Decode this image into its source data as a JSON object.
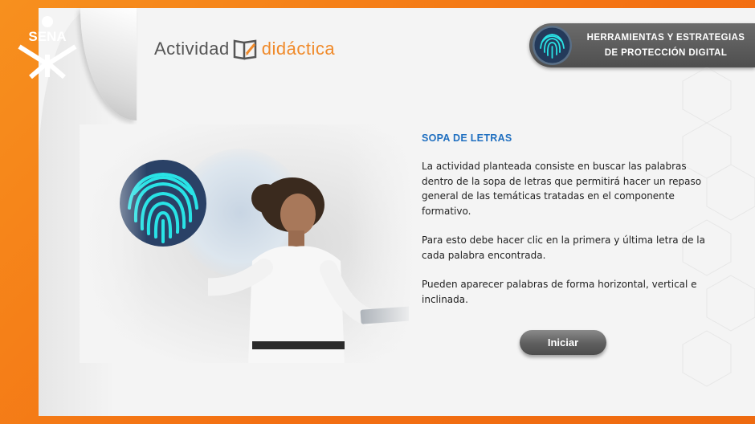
{
  "brand": {
    "logo_text": "SENA"
  },
  "activity": {
    "word1": "Actividad",
    "word2": "didáctica"
  },
  "header": {
    "line1": "HERRAMIENTAS Y ESTRATEGIAS",
    "line2": "DE PROTECCIÓN DIGITAL"
  },
  "content": {
    "title": "SOPA DE LETRAS",
    "paragraph1": "La actividad planteada consiste en buscar las palabras dentro de la sopa de letras que permitirá hacer un repaso general de las temáticas tratadas en el componente formativo.",
    "paragraph2": "Para esto debe hacer clic en la primera y última letra de la cada palabra encontrada.",
    "paragraph3": "Pueden aparecer palabras de forma horizontal, vertical e inclinada."
  },
  "actions": {
    "start_label": "Iniciar"
  },
  "colors": {
    "accent_orange": "#f47c1c",
    "title_blue": "#1f6fc0",
    "fingerprint_cyan": "#29e3e6",
    "badge_gray": "#5a5a5a"
  },
  "icons": [
    "sena-logo",
    "book-pencil-icon",
    "fingerprint-icon"
  ]
}
